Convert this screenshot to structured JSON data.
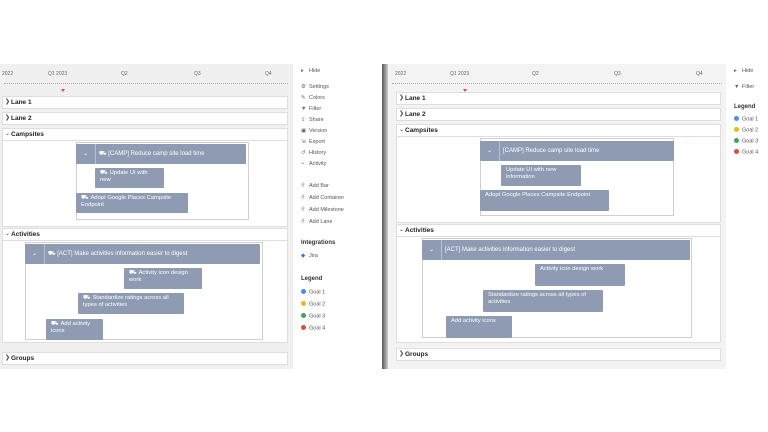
{
  "timeline": {
    "left": [
      "2022",
      "Q1 2023",
      "Q2",
      "Q3",
      "Q4"
    ],
    "right": [
      "2022",
      "Q1 2023",
      "Q2",
      "Q3",
      "Q4"
    ]
  },
  "lanes": {
    "lane1": "Lane 1",
    "lane2": "Lane 2",
    "campsites": "Campsites",
    "activities": "Activities",
    "groups": "Groups"
  },
  "left_bars": {
    "camp_container": "[CAMP] Reduce camp site load time",
    "update_ui": "Update UI with new",
    "adopt_places": "Adopt Google Places Campsite Endpoint",
    "act_container": "[ACT] Make activities information easier to digest",
    "activity_icon": "Activity icon design work",
    "standardize": "Standardize ratings across all types of activities",
    "add_icons": "Add activity icons"
  },
  "right_bars": {
    "camp_container": "[CAMP] Reduce camp site load time",
    "update_ui": "Update UI with new information",
    "adopt_places": "Adopt Google Places Campsite Endpoint",
    "act_container": "[ACT] Make activities information easier to digest",
    "activity_icon": "Activity icon design work",
    "standardize": "Standardize ratings across all types of activities",
    "add_icons": "Add activity icons"
  },
  "sidebar": {
    "hide": "Hide",
    "menu": [
      "Settings",
      "Colors",
      "Filter",
      "Share",
      "Version",
      "Export",
      "History",
      "Activity"
    ],
    "add": [
      "Add Bar",
      "Add Container",
      "Add Milestone",
      "Add Lane"
    ],
    "integrations_title": "Integrations",
    "jira": "Jira",
    "legend_title": "Legend",
    "goals": [
      "Goal 1",
      "Goal 2",
      "Goal 3",
      "Goal 4"
    ]
  },
  "right_sidebar": {
    "hide": "Hide",
    "filter": "Filter",
    "legend_title": "Legend",
    "goals": [
      "Goal 1",
      "Goal 2",
      "Goal 3",
      "Goal 4"
    ]
  },
  "colors": {
    "bar": "#8e9bb3",
    "goal1": "#4a90d9",
    "goal2": "#e8b923",
    "goal3": "#3aa65a",
    "goal4": "#e04b3c",
    "today_marker": "#e04b3c"
  },
  "icons": {
    "collapsed": "chevron-right-icon",
    "expanded": "chevron-down-icon",
    "bar_glyph": "people-icon"
  }
}
